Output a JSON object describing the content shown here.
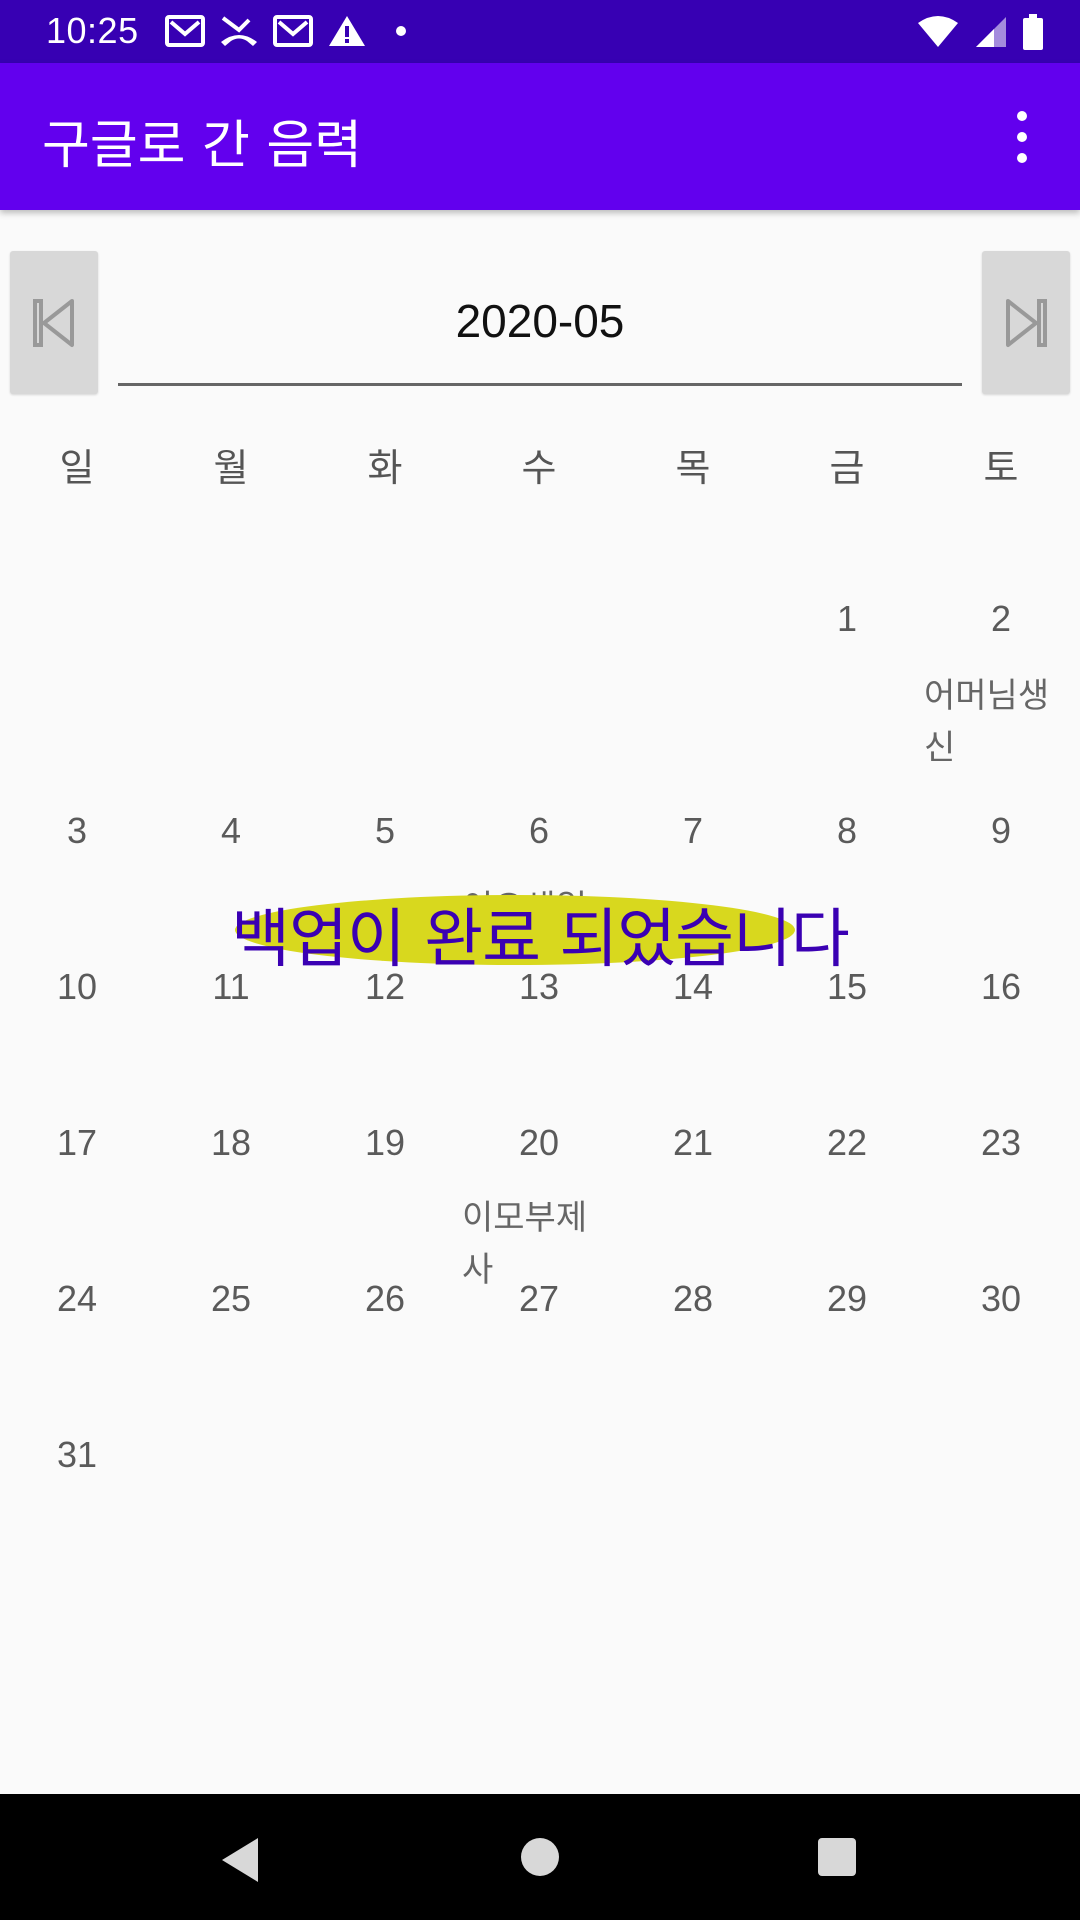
{
  "status_bar": {
    "time": "10:25",
    "left_icons": [
      "gmail-icon",
      "missed-call-icon",
      "gmail-icon",
      "warning-icon",
      "dot-icon"
    ],
    "right_icons": [
      "wifi-icon",
      "signal-icon",
      "battery-icon"
    ]
  },
  "app_bar": {
    "title": "구글로 간 음력",
    "menu_icon": "more-vert-icon"
  },
  "month_nav": {
    "month": "2020-05",
    "prev_icon": "skip-previous-icon",
    "next_icon": "skip-next-icon"
  },
  "calendar": {
    "weekdays": [
      "일",
      "월",
      "화",
      "수",
      "목",
      "금",
      "토"
    ],
    "days": [
      "1",
      "2",
      "3",
      "4",
      "5",
      "6",
      "7",
      "8",
      "9",
      "10",
      "11",
      "12",
      "13",
      "14",
      "15",
      "16",
      "17",
      "18",
      "19",
      "20",
      "21",
      "22",
      "23",
      "24",
      "25",
      "26",
      "27",
      "28",
      "29",
      "30",
      "31"
    ],
    "events": {
      "day2": "어머님생신",
      "day20": "이모부제사",
      "day6_partial": "이오생일"
    }
  },
  "toast": {
    "message": "백업이 완료 되었습니다"
  },
  "colors": {
    "status_bar": "#3700b3",
    "app_bar": "#6200ee",
    "toast_bg": "#d8d81e",
    "toast_text": "#3a00b3"
  }
}
